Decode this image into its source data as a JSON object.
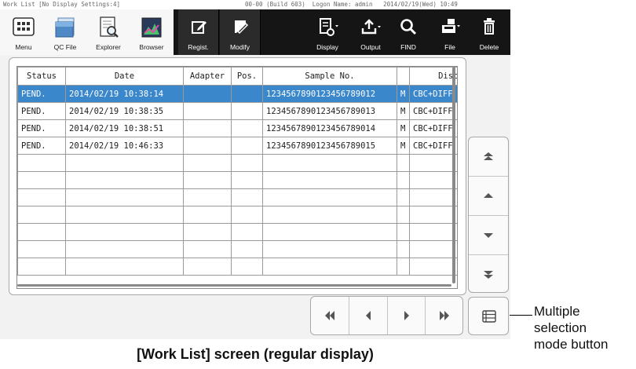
{
  "titlebar": {
    "left": "Work List [No Display Settings:4]",
    "right": "00-00 (Build 603)  Logon Name: admin   2014/02/19(Wed) 10:49"
  },
  "toolbar": {
    "menu_label": "Menu",
    "qcfile_label": "QC File",
    "explorer_label": "Explorer",
    "browser_label": "Browser",
    "regist_label": "Regist.",
    "modify_label": "Modify",
    "display_label": "Display",
    "output_label": "Output",
    "find_label": "FIND",
    "file_label": "File",
    "delete_label": "Delete"
  },
  "table": {
    "columns": [
      "Status",
      "Date",
      "Adapter",
      "Pos.",
      "Sample No.",
      "",
      "Discre"
    ],
    "rows": [
      {
        "status": "PEND.",
        "date": "2014/02/19 10:38:14",
        "adapter": "",
        "pos": "",
        "sample": "123456789012345678901​2",
        "mode": "M",
        "discrete": "CBC+DIFF",
        "selected": true
      },
      {
        "status": "PEND.",
        "date": "2014/02/19 10:38:35",
        "adapter": "",
        "pos": "",
        "sample": "1234567890123456789013",
        "mode": "M",
        "discrete": "CBC+DIFF",
        "selected": false
      },
      {
        "status": "PEND.",
        "date": "2014/02/19 10:38:51",
        "adapter": "",
        "pos": "",
        "sample": "1234567890123456789014",
        "mode": "M",
        "discrete": "CBC+DIFF",
        "selected": false
      },
      {
        "status": "PEND.",
        "date": "2014/02/19 10:46:33",
        "adapter": "",
        "pos": "",
        "sample": "1234567890123456789015",
        "mode": "M",
        "discrete": "CBC+DIFF",
        "selected": false
      }
    ]
  },
  "scroll_buttons": [
    "scroll-top-icon",
    "scroll-up-icon",
    "scroll-down-icon",
    "scroll-bottom-icon"
  ],
  "nav_buttons": [
    "first-page-icon",
    "previous-page-icon",
    "next-page-icon",
    "last-page-icon"
  ],
  "multi_select_icon": "list-view-icon",
  "annotation": {
    "callout": "Multiple\nselection\nmode button",
    "caption": "[Work List] screen (regular display)"
  },
  "colors": {
    "selected_row": "#3a87cc",
    "dark_toolbar": "#151515",
    "light_toolbar": "#f7f7f7"
  }
}
